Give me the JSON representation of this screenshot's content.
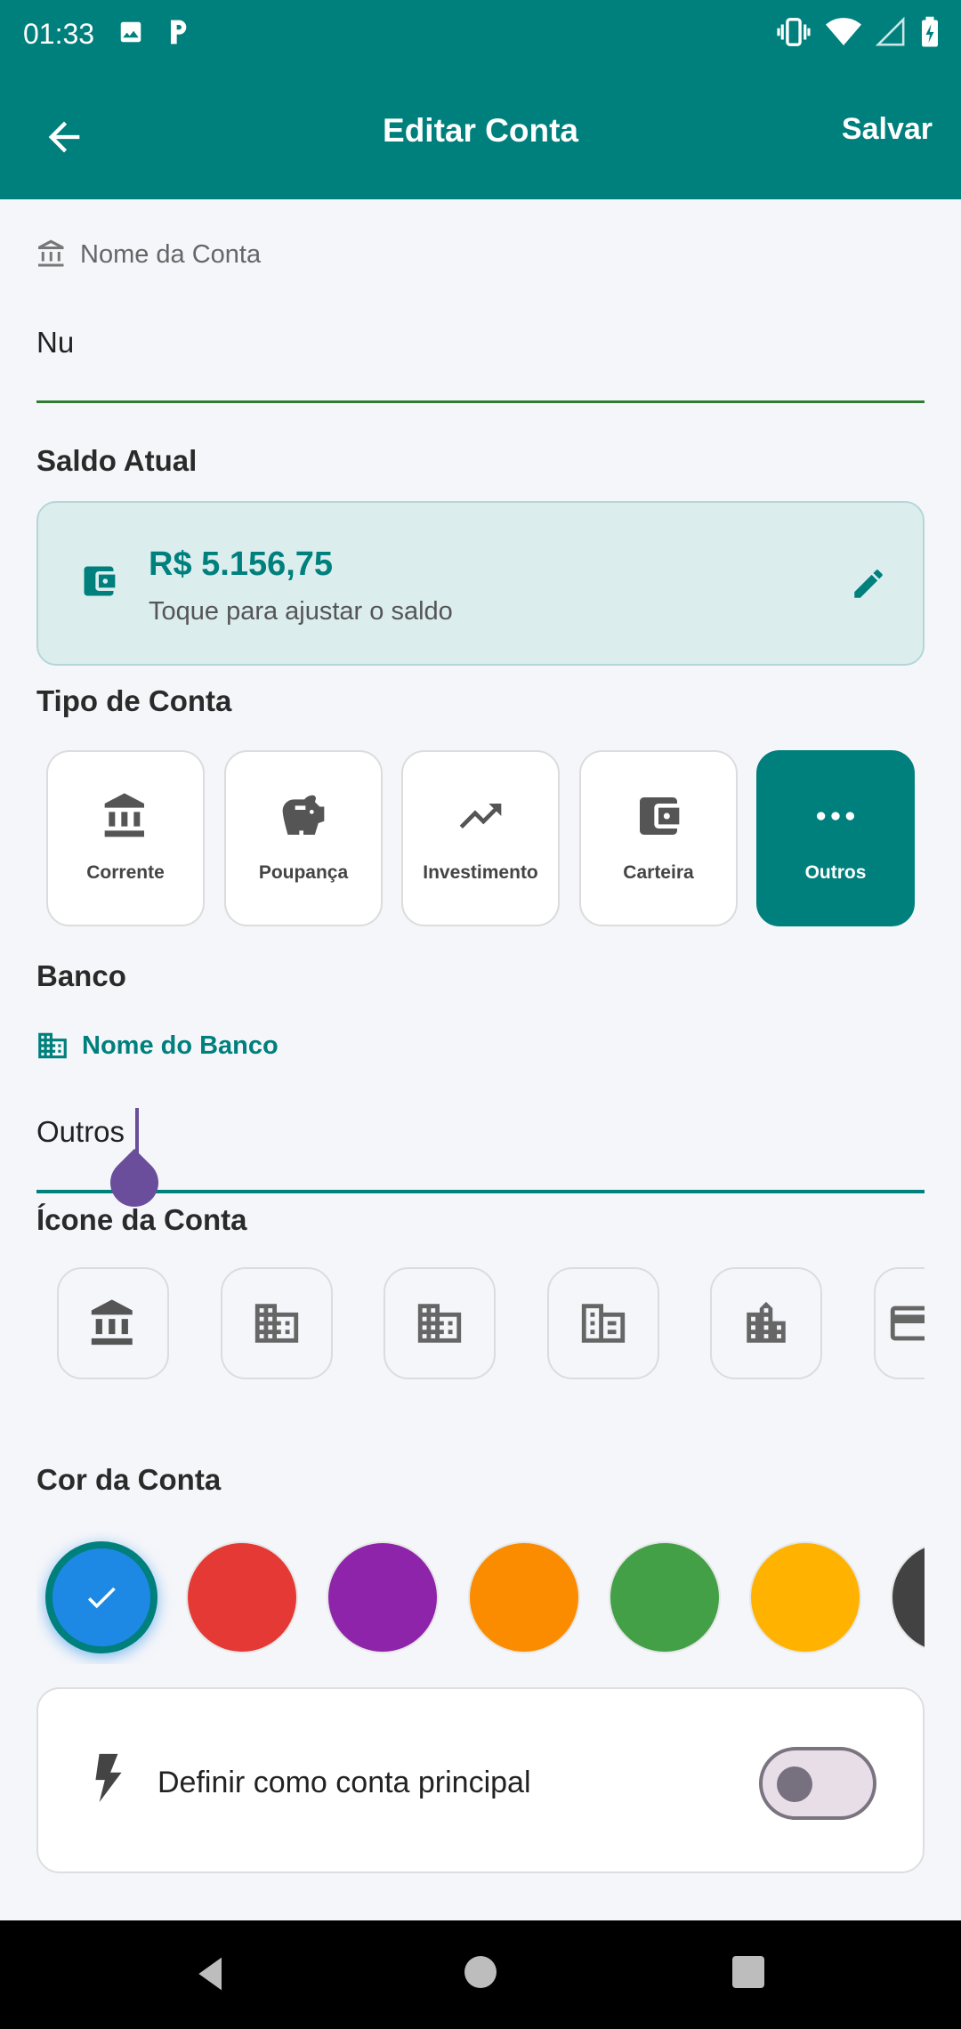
{
  "status": {
    "time": "01:33"
  },
  "appbar": {
    "title": "Editar Conta",
    "save_label": "Salvar"
  },
  "account_name": {
    "label": "Nome da Conta",
    "value": "Nu"
  },
  "balance": {
    "section_title": "Saldo Atual",
    "amount": "R$ 5.156,75",
    "hint": "Toque para ajustar o saldo"
  },
  "account_type": {
    "section_title": "Tipo de Conta",
    "options": [
      {
        "label": "Corrente",
        "icon": "bank-icon"
      },
      {
        "label": "Poupança",
        "icon": "piggy-bank-icon"
      },
      {
        "label": "Investimento",
        "icon": "trending-up-icon"
      },
      {
        "label": "Carteira",
        "icon": "wallet-icon"
      },
      {
        "label": "Outros",
        "icon": "more-horizontal-icon",
        "selected": true
      }
    ]
  },
  "bank": {
    "section_title": "Banco",
    "label": "Nome do Banco",
    "value": "Outros"
  },
  "account_icon": {
    "section_title": "Ícone da Conta",
    "icons": [
      "bank-icon",
      "business-icon",
      "corporate-icon",
      "office-icon",
      "city-icon",
      "card-icon"
    ]
  },
  "account_color": {
    "section_title": "Cor da Conta",
    "colors": [
      "#1E88E5",
      "#E53935",
      "#8E24AA",
      "#FB8C00",
      "#43A047",
      "#FFB300",
      "#424242"
    ],
    "selected_index": 0
  },
  "main_account": {
    "label": "Definir como conta principal",
    "enabled": false
  },
  "theme": {
    "primary": "#00807D",
    "background": "#F5F6FA"
  }
}
